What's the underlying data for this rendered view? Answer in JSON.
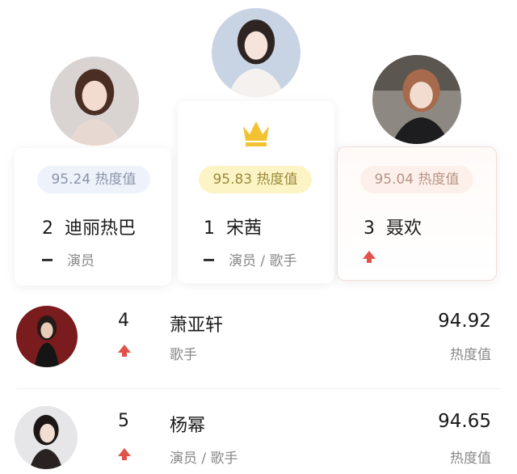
{
  "podium": [
    {
      "rank": "2",
      "name": "迪丽热巴",
      "score_text": "95.24 热度值",
      "role": "演员",
      "trend": "same"
    },
    {
      "rank": "1",
      "name": "宋茜",
      "score_text": "95.83 热度值",
      "role": "演员 / 歌手",
      "trend": "same"
    },
    {
      "rank": "3",
      "name": "聂欢",
      "score_text": "95.04 热度值",
      "role": "",
      "trend": "up"
    }
  ],
  "list": [
    {
      "rank": "4",
      "name": "萧亚轩",
      "role": "歌手",
      "score": "94.92",
      "score_label": "热度值",
      "trend": "up"
    },
    {
      "rank": "5",
      "name": "杨幂",
      "role": "演员 / 歌手",
      "score": "94.65",
      "score_label": "热度值",
      "trend": "up"
    }
  ],
  "colors": {
    "rank1_pill": "#fdf4c6",
    "rank2_pill": "#eef2fb",
    "rank3_pill": "#fdf0ea",
    "crown": "#f2c230",
    "trend_up": "#e0524a"
  },
  "icons": {
    "crown": "crown-icon",
    "trend_up": "arrow-up-icon",
    "trend_same": "dash-icon"
  }
}
